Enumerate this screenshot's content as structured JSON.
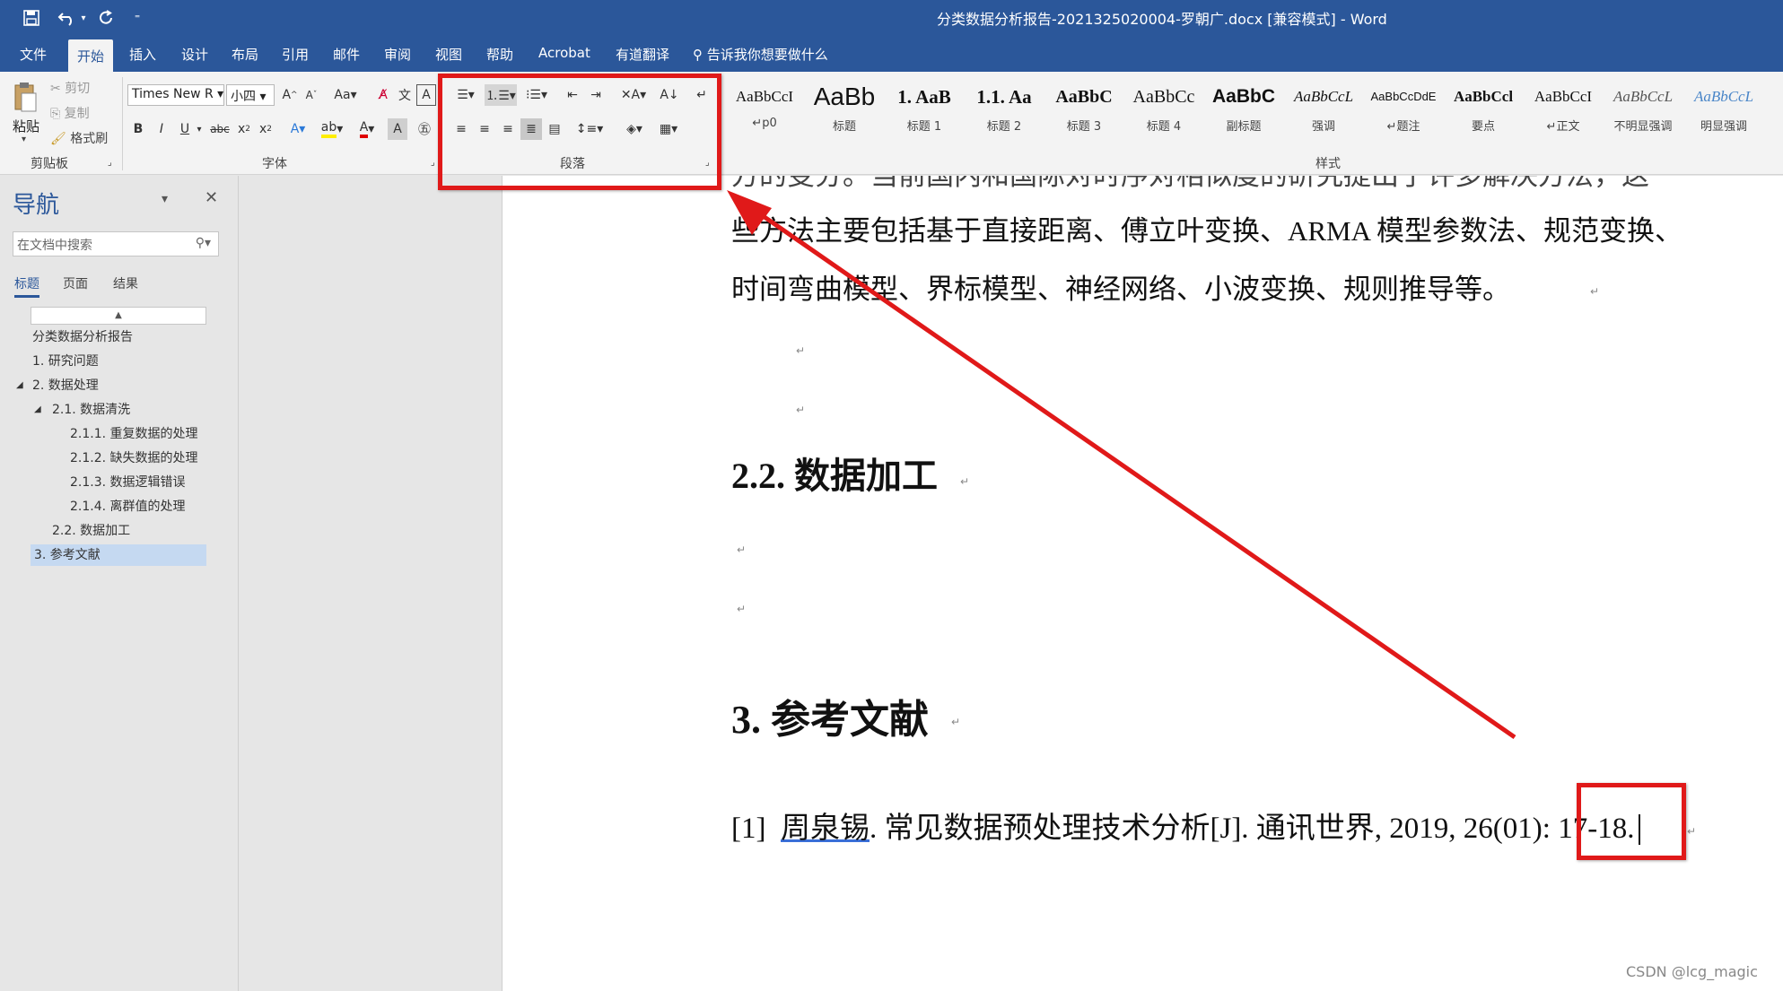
{
  "window": {
    "title": "分类数据分析报告-2021325020004-罗朝广.docx [兼容模式]  -  Word"
  },
  "tabs": [
    "文件",
    "开始",
    "插入",
    "设计",
    "布局",
    "引用",
    "邮件",
    "审阅",
    "视图",
    "帮助",
    "Acrobat",
    "有道翻译"
  ],
  "tell_me": "告诉我你想要做什么",
  "clipboard": {
    "paste": "粘贴",
    "cut": "剪切",
    "copy": "复制",
    "format_painter": "格式刷",
    "label": "剪贴板"
  },
  "font": {
    "name": "Times New R",
    "size": "小四",
    "change_case": "Aa",
    "label": "字体"
  },
  "paragraph": {
    "label": "段落"
  },
  "styles": {
    "label": "样式",
    "items": [
      {
        "sample": "AaBbCcI",
        "name": "p0",
        "mark": "↵"
      },
      {
        "sample": "AaBb",
        "name": "标题",
        "mark": ""
      },
      {
        "sample": "1. AaB",
        "name": "标题 1",
        "mark": ""
      },
      {
        "sample": "1.1. Aa",
        "name": "标题 2",
        "mark": ""
      },
      {
        "sample": "AaBbC",
        "name": "标题 3",
        "mark": ""
      },
      {
        "sample": "AaBbCc",
        "name": "标题 4",
        "mark": ""
      },
      {
        "sample": "AaBbC",
        "name": "副标题",
        "mark": ""
      },
      {
        "sample": "AaBbCcL",
        "name": "强调",
        "mark": ""
      },
      {
        "sample": "AaBbCcDdE",
        "name": "题注",
        "mark": "↵"
      },
      {
        "sample": "AaBbCcl",
        "name": "要点",
        "mark": ""
      },
      {
        "sample": "AaBbCcI",
        "name": "正文",
        "mark": "↵"
      },
      {
        "sample": "AaBbCcL",
        "name": "不明显强调",
        "mark": ""
      },
      {
        "sample": "AaBbCcL",
        "name": "明显强调",
        "mark": ""
      }
    ]
  },
  "navigation": {
    "title": "导航",
    "search_placeholder": "在文档中搜索",
    "tabs": [
      "标题",
      "页面",
      "结果"
    ],
    "items": [
      {
        "text": "分类数据分析报告"
      },
      {
        "text": "1. 研究问题"
      },
      {
        "text": "2. 数据处理",
        "toggle": "◢"
      },
      {
        "text": "2.1. 数据清洗",
        "toggle": "◢"
      },
      {
        "text": "2.1.1. 重复数据的处理"
      },
      {
        "text": "2.1.2. 缺失数据的处理"
      },
      {
        "text": "2.1.3. 数据逻辑错误"
      },
      {
        "text": "2.1.4. 离群值的处理"
      },
      {
        "text": "2.2. 数据加工"
      },
      {
        "text": "3. 参考文献"
      }
    ]
  },
  "document": {
    "line_partial": "方的变分。当前国内和国际对时序对相似度的研究提出了许多解决方法，这",
    "line1": "些方法主要包括基于直接距离、傅立叶变换、ARMA  模型参数法、规范变换、",
    "line2": "时间弯曲模型、界标模型、神经网络、小波变换、规则推导等。",
    "heading_22": "2.2.  数据加工",
    "heading_3": "3.  参考文献",
    "ref_num": "[1]",
    "ref_author": "周泉锡",
    "ref_rest": ". 常见数据预处理技术分析[J]. 通讯世界, 2019, 26(01): 17-18.",
    "para_mark": "↵"
  },
  "watermark": "CSDN @lcg_magic",
  "colors": {
    "word_blue": "#2b579a",
    "annotation_red": "#e01919",
    "nav_selected": "#c5d9f1"
  }
}
